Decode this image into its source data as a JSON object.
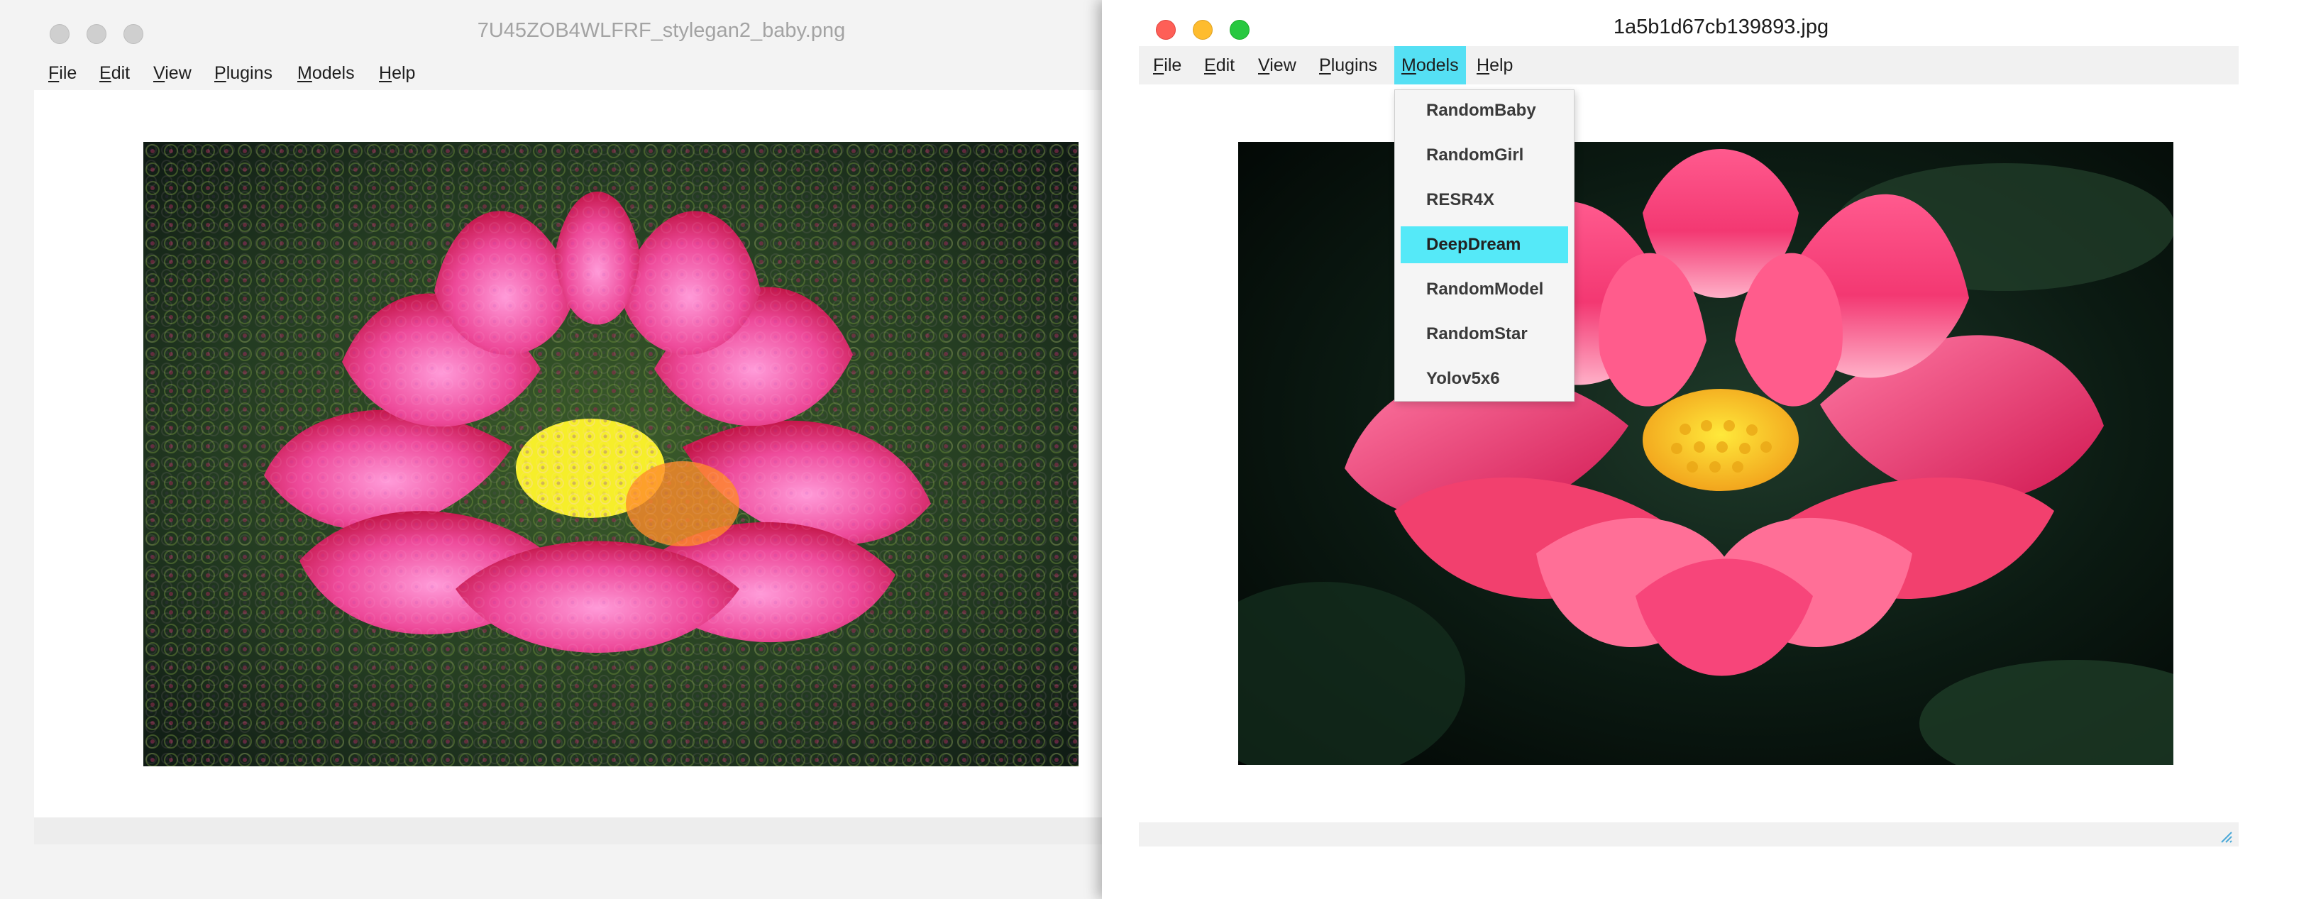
{
  "left_window": {
    "title": "7U45ZOB4WLFRF_stylegan2_baby.png",
    "menu": [
      {
        "label": "File",
        "mnemonic": "F",
        "rest": "ile"
      },
      {
        "label": "Edit",
        "mnemonic": "E",
        "rest": "dit"
      },
      {
        "label": "View",
        "mnemonic": "V",
        "rest": "iew"
      },
      {
        "label": "Plugins",
        "mnemonic": "P",
        "rest": "lugins"
      },
      {
        "label": "Models",
        "mnemonic": "M",
        "rest": "odels"
      },
      {
        "label": "Help",
        "mnemonic": "H",
        "rest": "elp"
      }
    ],
    "image": {
      "description_icon": "deepdream-lotus-image"
    }
  },
  "right_window": {
    "title": "1a5b1d67cb139893.jpg",
    "menu": [
      {
        "label": "File",
        "mnemonic": "F",
        "rest": "ile"
      },
      {
        "label": "Edit",
        "mnemonic": "E",
        "rest": "dit"
      },
      {
        "label": "View",
        "mnemonic": "V",
        "rest": "iew"
      },
      {
        "label": "Plugins",
        "mnemonic": "P",
        "rest": "lugins"
      },
      {
        "label": "Models",
        "mnemonic": "M",
        "rest": "odels",
        "active": true
      },
      {
        "label": "Help",
        "mnemonic": "H",
        "rest": "elp"
      }
    ],
    "models_menu": {
      "items": [
        "RandomBaby",
        "RandomGirl",
        "RESR4X",
        "DeepDream",
        "RandomModel",
        "RandomStar",
        "Yolov5x6"
      ],
      "selected": "DeepDream"
    },
    "image": {
      "description_icon": "lotus-photo-image"
    }
  },
  "colors": {
    "menu_highlight": "#55e0f4",
    "close": "#fe5f57",
    "minimize": "#febc2e",
    "maximize": "#28c840",
    "inactive_light": "#cfcfcf"
  }
}
